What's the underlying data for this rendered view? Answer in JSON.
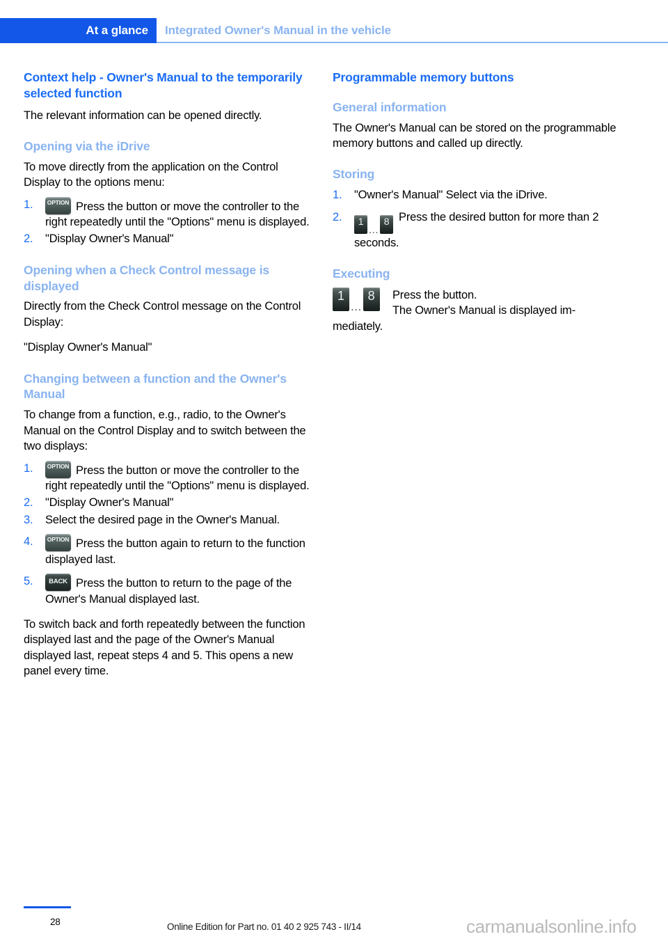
{
  "header": {
    "tab_label": "At a glance",
    "section_title": "Integrated Owner's Manual in the vehicle"
  },
  "left_column": {
    "title": "Context help - Owner's Manual to the temporarily selected function",
    "intro": "The relevant information can be opened directly.",
    "subsection_1": {
      "title": "Opening via the iDrive",
      "intro": "To move directly from the application on the Control Display to the options menu:",
      "steps": [
        {
          "num": "1.",
          "icon": "option-button-icon",
          "icon_label": "OPTION",
          "text": "Press the button or move the controller to the right repeatedly until the \"Options\" menu is displayed."
        },
        {
          "num": "2.",
          "icon": "",
          "icon_label": "",
          "text": "\"Display Owner's Manual\""
        }
      ]
    },
    "subsection_2": {
      "title": "Opening when a Check Control message is displayed",
      "intro": "Directly from the Check Control message on the Control Display:",
      "quote": "\"Display Owner's Manual\""
    },
    "subsection_3": {
      "title": "Changing between a function and the Owner's Manual",
      "intro": "To change from a function, e.g., radio, to the Owner's Manual on the Control Display and to switch between the two displays:",
      "steps": [
        {
          "num": "1.",
          "icon": "option-button-icon",
          "icon_label": "OPTION",
          "text": "Press the button or move the controller to the right repeatedly until the \"Options\" menu is displayed."
        },
        {
          "num": "2.",
          "icon": "",
          "icon_label": "",
          "text": "\"Display Owner's Manual\""
        },
        {
          "num": "3.",
          "icon": "",
          "icon_label": "",
          "text": "Select the desired page in the Owner's Manual."
        },
        {
          "num": "4.",
          "icon": "option-button-icon",
          "icon_label": "OPTION",
          "text": "Press the button again to return to the function displayed last."
        },
        {
          "num": "5.",
          "icon": "back-button-icon",
          "icon_label": "BACK",
          "text": "Press the button to return to the page of the Owner's Manual displayed last."
        }
      ],
      "outro": "To switch back and forth repeatedly between the function displayed last and the page of the Owner's Manual displayed last, repeat steps 4 and 5. This opens a new panel every time."
    }
  },
  "right_column": {
    "title": "Programmable memory buttons",
    "subsection_1": {
      "title": "General information",
      "text": "The Owner's Manual can be stored on the programmable memory buttons and called up directly."
    },
    "subsection_2": {
      "title": "Storing",
      "steps": [
        {
          "num": "1.",
          "icon": "",
          "text": "\"Owner's Manual\" Select via the iDrive."
        },
        {
          "num": "2.",
          "icon": "memory-buttons-icon",
          "text": "Press the desired button for more than 2 seconds."
        }
      ]
    },
    "subsection_3": {
      "title": "Executing",
      "icon": "memory-buttons-icon",
      "line_1": "Press the button.",
      "line_2": "The Owner's Manual is displayed im-",
      "line_3": "mediately."
    }
  },
  "memory_buttons": {
    "first_digit": "1",
    "dots": "...",
    "last_digit": "8"
  },
  "footer": {
    "page_number": "28",
    "edition": "Online Edition for Part no. 01 40 2 925 743 - II/14",
    "watermark": "carmanualsonline.info"
  },
  "colors": {
    "tab_background": "#1257e8",
    "heading_blue": "#1a6cf5",
    "subheading_blue": "#8ab4f0",
    "body_text": "#000000"
  }
}
